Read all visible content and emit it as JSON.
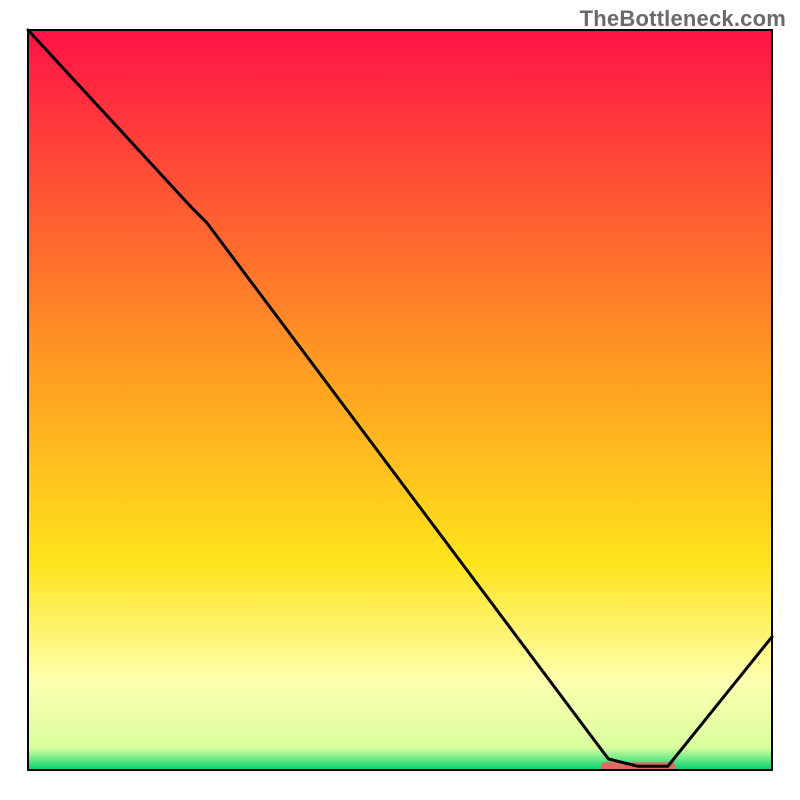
{
  "attribution": "TheBottleneck.com",
  "chart_data": {
    "type": "line",
    "title": "",
    "xlabel": "",
    "ylabel": "",
    "xlim": [
      0,
      100
    ],
    "ylim": [
      0,
      100
    ],
    "background_gradient": {
      "stops": [
        {
          "offset": 0.0,
          "color": "#ff1246"
        },
        {
          "offset": 0.45,
          "color": "#ff9a22"
        },
        {
          "offset": 0.72,
          "color": "#ffe41c"
        },
        {
          "offset": 0.88,
          "color": "#feffb0"
        },
        {
          "offset": 0.97,
          "color": "#d9ff9e"
        },
        {
          "offset": 1.0,
          "color": "#00d370"
        }
      ]
    },
    "minimum_band": {
      "x_range": [
        77,
        87
      ],
      "y": 0.5,
      "color": "#e26a62"
    },
    "series": [
      {
        "name": "curve",
        "x": [
          0,
          22,
          24,
          78,
          82,
          86,
          100
        ],
        "y": [
          100,
          76,
          74,
          1.5,
          0.5,
          0.5,
          18
        ]
      }
    ]
  }
}
